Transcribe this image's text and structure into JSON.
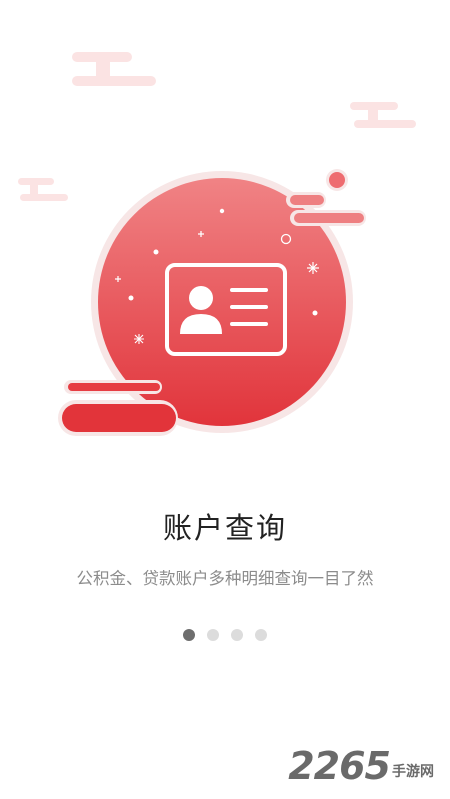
{
  "slide": {
    "title": "账户查询",
    "subtitle": "公积金、贷款账户多种明细查询一目了然",
    "page_count": 4,
    "active_index": 0
  },
  "watermark": {
    "number": "2265",
    "text": "手游网"
  },
  "icons": {
    "main": "id-card-icon"
  },
  "colors": {
    "accent": "#e6393f",
    "accent_light": "#f08a8c",
    "decor_pink": "#fbe3e3"
  }
}
